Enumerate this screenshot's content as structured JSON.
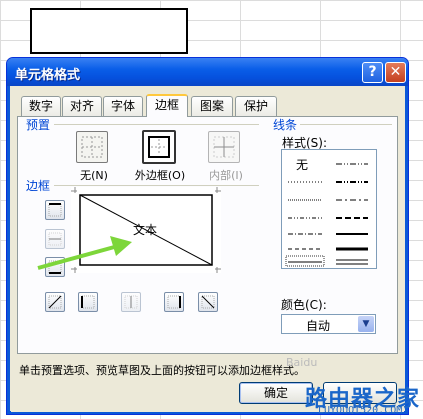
{
  "dialog": {
    "title": "单元格格式",
    "help_icon": "?",
    "close_icon": "✕"
  },
  "tabs": [
    "数字",
    "对齐",
    "字体",
    "边框",
    "图案",
    "保护"
  ],
  "active_tab": "边框",
  "presets": {
    "group_label": "预置",
    "none_label": "无(N)",
    "outline_label": "外边框(O)",
    "inside_label": "内部(I)"
  },
  "border": {
    "group_label": "边框",
    "preview_text": "文本"
  },
  "line": {
    "group_label": "线条",
    "style_label": "样式(S):",
    "none_label": "无",
    "color_label": "颜色(C):",
    "color_value": "自动"
  },
  "hint": "单击预置选项、预览草图及上面的按钮可以添加边框样式。",
  "buttons": {
    "ok": "确定",
    "cancel": ""
  },
  "watermark": {
    "main": "路由器之家",
    "url": "LUYOUQI520.COM",
    "faint": "Baidu"
  },
  "colors": {
    "accent_arrow": "#7dd63a",
    "titlebar": "#0a5ee8",
    "group_label": "#0046d5"
  }
}
